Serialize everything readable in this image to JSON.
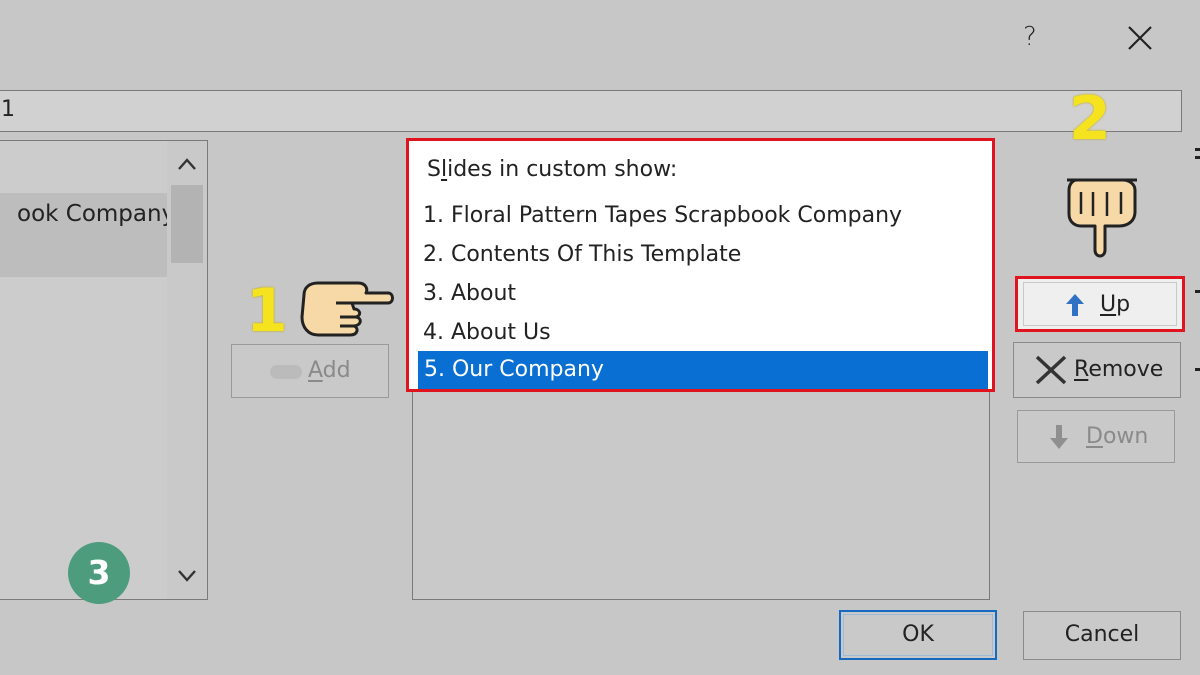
{
  "title_bar": {
    "help_label": "?",
    "close_icon": "close-x-icon"
  },
  "name_field": {
    "value": "1"
  },
  "left_list": {
    "items": [
      {
        "label": "ook Company"
      }
    ]
  },
  "add_button": {
    "mnemonic": "A",
    "rest": "dd"
  },
  "right_list": {
    "caption_pre": "S",
    "caption_mnemonic": "l",
    "caption_post": "ides in custom show:",
    "items": [
      {
        "label": "1. Floral Pattern Tapes Scrapbook Company"
      },
      {
        "label": "2. Contents Of This Template"
      },
      {
        "label": "3. About"
      },
      {
        "label": "4. About Us"
      },
      {
        "label": "5. Our Company"
      }
    ],
    "selected_index": 4
  },
  "side_buttons": {
    "up": {
      "mnemonic": "U",
      "rest": "p"
    },
    "remove": {
      "mnemonic": "R",
      "rest": "emove"
    },
    "down": {
      "mnemonic": "D",
      "rest": "own"
    }
  },
  "footer": {
    "ok_label": "OK",
    "cancel_label": "Cancel"
  },
  "annotations": {
    "step1": "1",
    "step2": "2",
    "step3": "3"
  },
  "colors": {
    "selection": "#0a6fd2",
    "highlight_border": "#e0141e",
    "step_number": "#f4e31e",
    "step_badge": "#4e9c7e",
    "up_arrow": "#2f72c4"
  },
  "icons": {
    "hand_point_right": "pointing-right-hand-icon",
    "hand_point_down": "pointing-down-hand-icon",
    "up_arrow": "arrow-up-icon",
    "remove": "x-icon",
    "down_arrow": "arrow-down-icon",
    "scroll_up": "chevron-up-icon",
    "scroll_down": "chevron-down-icon"
  }
}
